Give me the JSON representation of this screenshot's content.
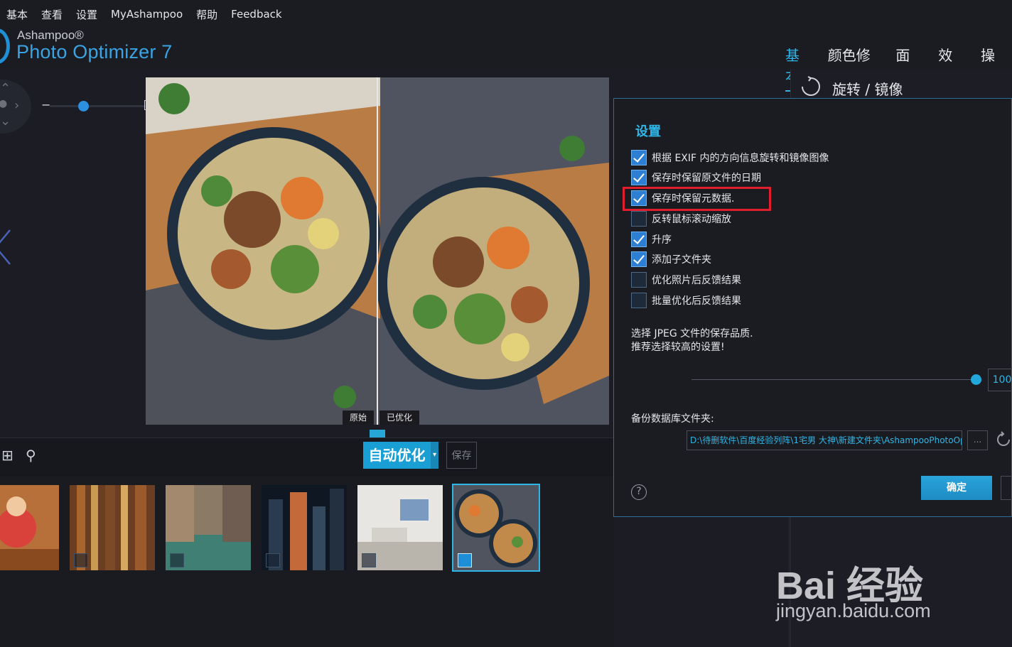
{
  "menu": [
    "基本",
    "查看",
    "设置",
    "MyAshampoo",
    "帮助",
    "Feedback"
  ],
  "brand": {
    "company": "Ashampoo®",
    "product": "Photo Optimizer 7"
  },
  "tabs": [
    {
      "label": "基本",
      "active": true
    },
    {
      "label": "颜色修正",
      "active": false
    },
    {
      "label": "面部",
      "active": false
    },
    {
      "label": "效果",
      "active": false
    },
    {
      "label": "操",
      "active": false
    }
  ],
  "zoom": {
    "minus": "−",
    "plus": "+",
    "level": 0.35
  },
  "preview": {
    "before_label": "原始",
    "after_label": "已优化"
  },
  "toolbar": {
    "auto_optimize": "自动优化",
    "save": "保存"
  },
  "thumbnails": [
    {
      "name": "child-autumn",
      "checked": false,
      "selected": false
    },
    {
      "name": "bookshelf",
      "checked": false,
      "selected": false
    },
    {
      "name": "venice-canal",
      "checked": false,
      "selected": false
    },
    {
      "name": "city-night",
      "checked": false,
      "selected": false
    },
    {
      "name": "living-room",
      "checked": false,
      "selected": false
    },
    {
      "name": "noodle-bowls",
      "checked": true,
      "selected": true
    }
  ],
  "right_panel": {
    "section_title": "旋转 / 镜像"
  },
  "settings": {
    "title": "设置",
    "options": [
      {
        "label": "根据 EXIF 内的方向信息旋转和镜像图像",
        "checked": true
      },
      {
        "label": "保存时保留原文件的日期",
        "checked": true
      },
      {
        "label": "保存时保留元数据.",
        "checked": true
      },
      {
        "label": "反转鼠标滚动缩放",
        "checked": false
      },
      {
        "label": "升序",
        "checked": true
      },
      {
        "label": "添加子文件夹",
        "checked": true
      },
      {
        "label": "优化照片后反馈结果",
        "checked": false
      },
      {
        "label": "批量优化后反馈结果",
        "checked": false
      }
    ],
    "jpeg_note_line1": "选择 JPEG 文件的保存品质.",
    "jpeg_note_line2": "推荐选择较高的设置!",
    "jpeg_quality": "100",
    "backup_label": "备份数据库文件夹:",
    "backup_path": "D:\\待删软件\\百度经验列阵\\1宅男 大神\\新建文件夹\\AshampooPhotoOpt",
    "browse": "...",
    "help": "?",
    "ok": "确定"
  },
  "watermark": {
    "line1": "Bai 经验",
    "line2": "jingyan.baidu.com"
  },
  "colors": {
    "accent": "#2fb6e8",
    "button": "#1a9fd5",
    "highlight": "#e01e2d",
    "background": "#1c1d24"
  }
}
